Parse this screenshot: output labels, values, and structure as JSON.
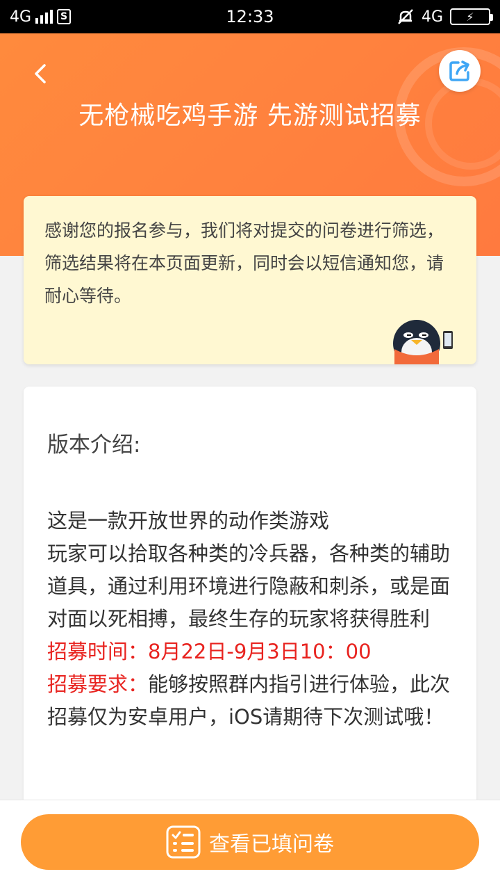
{
  "status_bar": {
    "network_left": "4G",
    "sim_label": "S",
    "time": "12:33",
    "network_right": "4G"
  },
  "header": {
    "title": "无枪械吃鸡手游 先游测试招募",
    "back_icon": "chevron-left-icon",
    "share_icon": "share-icon"
  },
  "notice": {
    "text": "感谢您的报名参与，我们将对提交的问卷进行筛选，筛选结果将在本页面更新，同时会以短信通知您，请耐心等待。"
  },
  "content": {
    "section_title": "版本介绍:",
    "desc_line1": "这是一款开放世界的动作类游戏",
    "desc_line2": "玩家可以拾取各种类的冷兵器，各种类的辅助道具，通过利用环境进行隐蔽和刺杀，或是面对面以死相搏，最终生存的玩家将获得胜利",
    "time_label": "招募时间：",
    "time_value": "8月22日-9月3日10：00",
    "req_label": "招募要求：",
    "req_value": "能够按照群内指引进行体验，此次招募仅为安卓用户，iOS请期待下次测试哦！"
  },
  "bottom": {
    "button_label": "查看已填问卷",
    "button_icon": "checklist-icon"
  },
  "colors": {
    "header_orange": "#ff7f3f",
    "button_orange": "#ff9c35",
    "notice_bg": "#fff8d2",
    "highlight_red": "#e8231f",
    "share_blue": "#3fa6f5"
  }
}
